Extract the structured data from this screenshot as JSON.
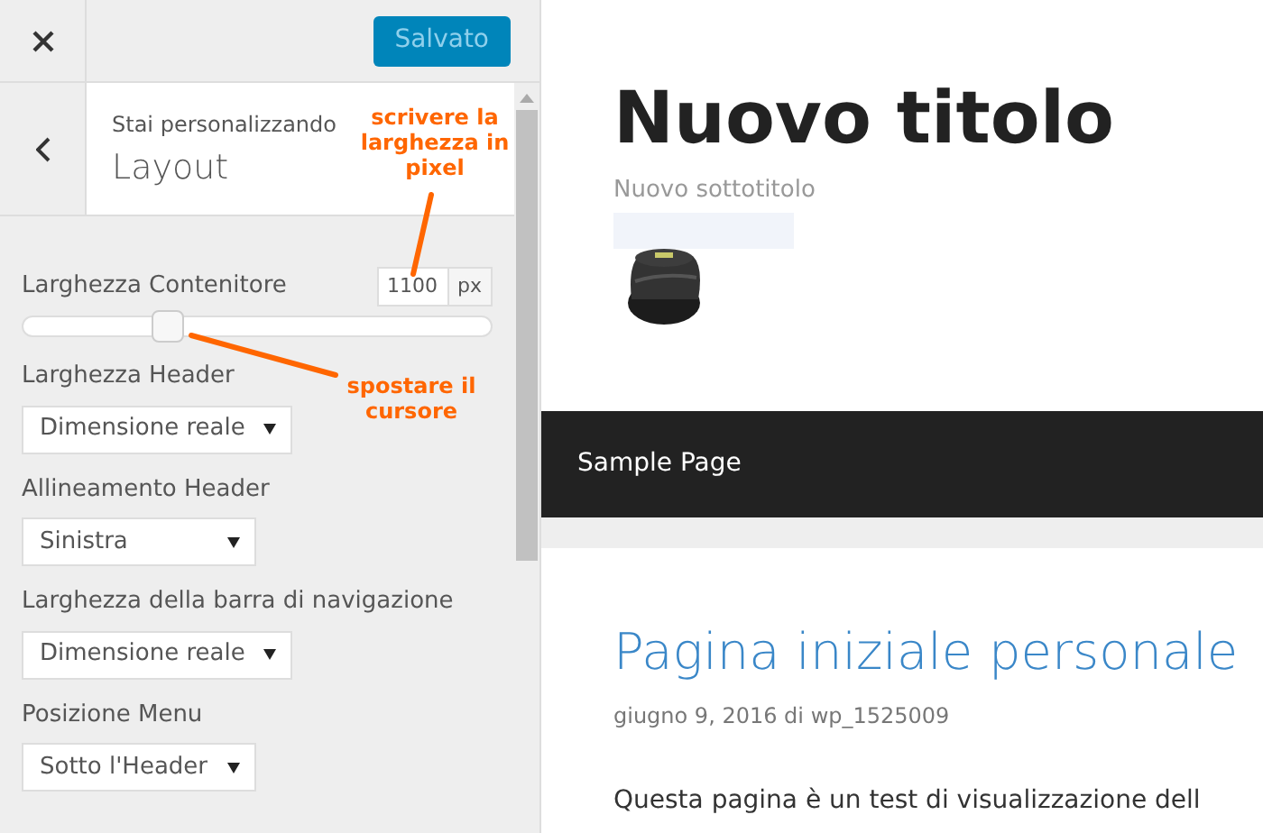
{
  "customizer": {
    "save_button": "Salvato",
    "context_label": "Stai personalizzando",
    "section_title": "Layout",
    "controls": [
      {
        "kind": "slider",
        "label": "Larghezza Contenitore",
        "value": "1100",
        "unit": "px",
        "level": 0.31
      },
      {
        "kind": "select",
        "label": "Larghezza Header",
        "value": "Dimensione reale"
      },
      {
        "kind": "select",
        "label": "Allineamento Header",
        "value": "Sinistra"
      },
      {
        "kind": "select",
        "label": "Larghezza della barra di navigazione",
        "value": "Dimensione reale"
      },
      {
        "kind": "select",
        "label": "Posizione Menu",
        "value": "Sotto l'Header"
      }
    ]
  },
  "annotations": [
    {
      "text": "scrivere la larghezza in pixel"
    },
    {
      "text": "spostare il cursore"
    }
  ],
  "preview": {
    "site_title": "Nuovo titolo",
    "tagline": "Nuovo sottotitolo",
    "header_image": {
      "kind": "picture"
    },
    "menu": [
      "Sample Page"
    ],
    "post": {
      "title": "Pagina iniziale personale",
      "meta": "giugno 9, 2016 di wp_1525009",
      "excerpt": "Questa pagina è un test di visualizzazione dell"
    }
  }
}
